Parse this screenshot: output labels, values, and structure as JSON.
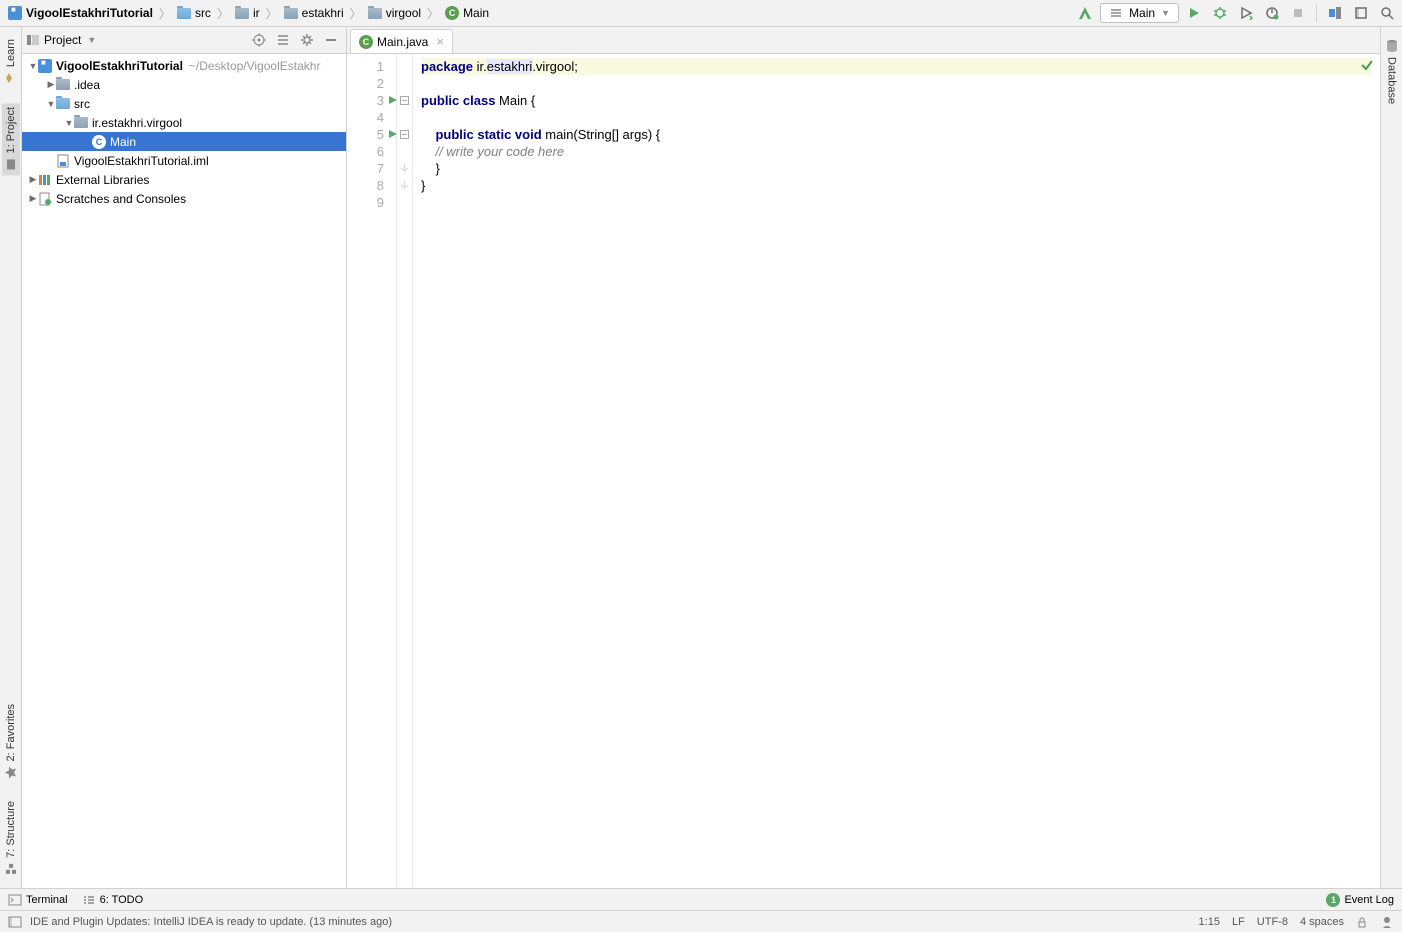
{
  "breadcrumbs": [
    {
      "label": "VigoolEstakhriTutorial",
      "icon": "module"
    },
    {
      "label": "src",
      "icon": "folder"
    },
    {
      "label": "ir",
      "icon": "folder"
    },
    {
      "label": "estakhri",
      "icon": "folder"
    },
    {
      "label": "virgool",
      "icon": "folder"
    },
    {
      "label": "Main",
      "icon": "class"
    }
  ],
  "run_config": {
    "label": "Main"
  },
  "project_pane": {
    "title": "Project",
    "items": [
      {
        "depth": 0,
        "arrow": "▼",
        "icon": "module",
        "label": "VigoolEstakhriTutorial",
        "dim": "~/Desktop/VigoolEstakhr"
      },
      {
        "depth": 1,
        "arrow": "▶",
        "icon": "folder-grey",
        "label": ".idea"
      },
      {
        "depth": 1,
        "arrow": "▼",
        "icon": "folder",
        "label": "src"
      },
      {
        "depth": 2,
        "arrow": "▼",
        "icon": "folder-grey",
        "label": "ir.estakhri.virgool"
      },
      {
        "depth": 3,
        "arrow": "",
        "icon": "class",
        "label": "Main",
        "selected": true
      },
      {
        "depth": 1,
        "arrow": "",
        "icon": "iml",
        "label": "VigoolEstakhriTutorial.iml"
      },
      {
        "depth": 0,
        "arrow": "▶",
        "icon": "lib",
        "label": "External Libraries"
      },
      {
        "depth": 0,
        "arrow": "▶",
        "icon": "scratch",
        "label": "Scratches and Consoles"
      }
    ]
  },
  "left_tabs": [
    "Learn",
    "1: Project",
    "2: Favorites",
    "7: Structure"
  ],
  "right_tabs": [
    "Database"
  ],
  "file_tab": {
    "label": "Main.java"
  },
  "code": {
    "lines": [
      {
        "n": 1,
        "hl": true,
        "tokens": [
          {
            "t": "package ",
            "c": "kw"
          },
          {
            "t": "ir.",
            "c": "pk"
          },
          {
            "t": "estakhri",
            "c": "pk",
            "bg": "#e8e8ff"
          },
          {
            "t": ".virgool;",
            "c": "pk"
          }
        ]
      },
      {
        "n": 2,
        "tokens": []
      },
      {
        "n": 3,
        "run": true,
        "fold": "open",
        "tokens": [
          {
            "t": "public class ",
            "c": "kw"
          },
          {
            "t": "Main {",
            "c": "ident"
          }
        ]
      },
      {
        "n": 4,
        "tokens": []
      },
      {
        "n": 5,
        "run": true,
        "fold": "open",
        "tokens": [
          {
            "t": "    ",
            "c": ""
          },
          {
            "t": "public static void ",
            "c": "kw"
          },
          {
            "t": "main(String[] args) {",
            "c": "ident"
          }
        ]
      },
      {
        "n": 6,
        "tokens": [
          {
            "t": "    ",
            "c": ""
          },
          {
            "t": "// write your code here",
            "c": "comment"
          }
        ]
      },
      {
        "n": 7,
        "fold": "close",
        "tokens": [
          {
            "t": "    }",
            "c": "ident"
          }
        ]
      },
      {
        "n": 8,
        "fold": "close",
        "tokens": [
          {
            "t": "}",
            "c": "ident"
          }
        ]
      },
      {
        "n": 9,
        "tokens": []
      }
    ]
  },
  "bottom_tools": {
    "terminal": "Terminal",
    "todo": "6: TODO",
    "event_log": "Event Log"
  },
  "status": {
    "message": "IDE and Plugin Updates: IntelliJ IDEA is ready to update. (13 minutes ago)",
    "pos": "1:15",
    "sep": "LF",
    "enc": "UTF-8",
    "indent": "4 spaces"
  }
}
